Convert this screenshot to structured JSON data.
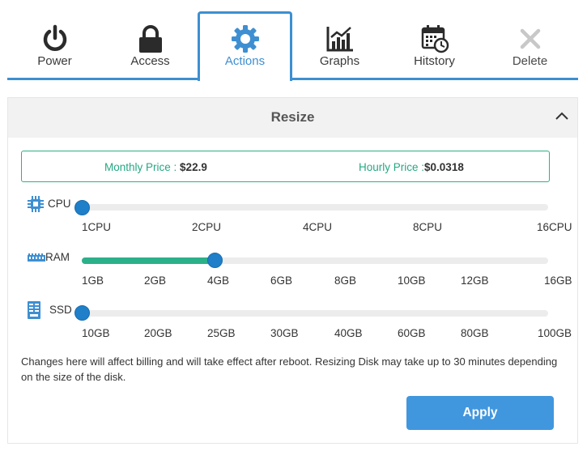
{
  "tabs": [
    {
      "label": "Power",
      "icon": "power-icon"
    },
    {
      "label": "Access",
      "icon": "lock-icon"
    },
    {
      "label": "Actions",
      "icon": "gear-icon"
    },
    {
      "label": "Graphs",
      "icon": "graph-icon"
    },
    {
      "label": "Hitstory",
      "icon": "calendar-clock-icon"
    },
    {
      "label": "Delete",
      "icon": "close-icon"
    }
  ],
  "active_tab": "Actions",
  "panel": {
    "title": "Resize",
    "monthly_label": "Monthly Price :",
    "monthly_value": "$22.9",
    "hourly_label": "Hourly Price :",
    "hourly_value": "$0.0318"
  },
  "sliders": {
    "cpu": {
      "label": "CPU",
      "icon": "cpu-icon",
      "options": [
        "1CPU",
        "2CPU",
        "4CPU",
        "8CPU",
        "16CPU"
      ],
      "selected": "1CPU"
    },
    "ram": {
      "label": "RAM",
      "icon": "ram-icon",
      "options": [
        "1GB",
        "2GB",
        "4GB",
        "6GB",
        "8GB",
        "10GB",
        "12GB",
        "16GB"
      ],
      "selected": "4GB"
    },
    "ssd": {
      "label": "SSD",
      "icon": "ssd-icon",
      "options": [
        "10GB",
        "20GB",
        "25GB",
        "30GB",
        "40GB",
        "60GB",
        "80GB",
        "100GB"
      ],
      "selected": "10GB"
    }
  },
  "note": "Changes here will affect billing and will take effect after reboot. Resizing Disk may take up to 30 minutes depending on the size of the disk.",
  "apply_label": "Apply",
  "colors": {
    "accent": "#3d8fd1",
    "green": "#2bb08a",
    "knob": "#1f7fc9",
    "button": "#4197de"
  }
}
